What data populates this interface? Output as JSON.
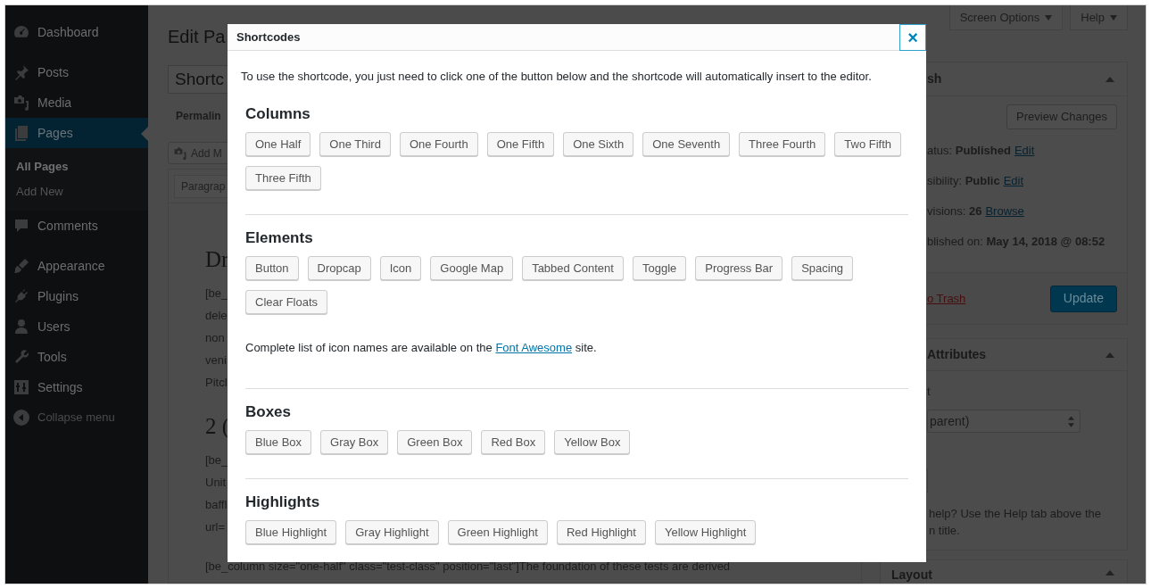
{
  "sidebar": {
    "items": [
      {
        "label": "Dashboard",
        "selected": false
      },
      {
        "label": "Posts",
        "selected": false
      },
      {
        "label": "Media",
        "selected": false
      },
      {
        "label": "Pages",
        "selected": true,
        "children": [
          {
            "label": "All Pages",
            "selected": true
          },
          {
            "label": "Add New",
            "selected": false
          }
        ]
      },
      {
        "label": "Comments",
        "selected": false
      },
      {
        "label": "Appearance",
        "selected": false
      },
      {
        "label": "Plugins",
        "selected": false
      },
      {
        "label": "Users",
        "selected": false
      },
      {
        "label": "Tools",
        "selected": false
      },
      {
        "label": "Settings",
        "selected": false
      }
    ],
    "collapse": "Collapse menu"
  },
  "top_buttons": [
    {
      "label": "Screen Options"
    },
    {
      "label": "Help"
    }
  ],
  "editor": {
    "heading": "Edit Pa",
    "title_value": "Shortc",
    "permalink": "Permalin",
    "add_media": "Add M",
    "format": "Paragrap",
    "content": [
      {
        "kind": "heading",
        "text": "Dr"
      },
      {
        "kind": "line",
        "text": "[be_"
      },
      {
        "kind": "line",
        "text": "dele"
      },
      {
        "kind": "line",
        "text": "non"
      },
      {
        "kind": "line",
        "text": "veni"
      },
      {
        "kind": "line",
        "text": "Pitcl"
      },
      {
        "kind": "heading",
        "text": "2 ("
      },
      {
        "kind": "line",
        "text": "[be_"
      },
      {
        "kind": "line",
        "text": "Unit"
      },
      {
        "kind": "line",
        "text": "baffl"
      },
      {
        "kind": "line",
        "text": "url="
      },
      {
        "kind": "line",
        "text": "[be_column size=\"one-half\" class=\"test-class\" position=\"last\"]The foundation of these tests are derived"
      }
    ]
  },
  "publish": {
    "title": "sh",
    "preview": "Preview Changes",
    "rows": [
      {
        "text": "atus: **Published**",
        "link": "Edit"
      },
      {
        "text": "sibility: **Public**",
        "link": "Edit"
      },
      {
        "text": "visions: **26**",
        "link": "Browse"
      },
      {
        "text": "blished on: **May 14, 2018 @ 08:52**"
      }
    ],
    "trash": "o Trash",
    "update": "Update"
  },
  "attributes": {
    "title": "Attributes",
    "label": "t",
    "select_value": "parent)",
    "help": "help? Use the Help tab above the",
    "help_2": "n title."
  },
  "layout": {
    "title": "Layout"
  },
  "modal": {
    "title": "Shortcodes",
    "close": "×",
    "intro": "To use the shortcode, you just need to click one of the button below and the shortcode will automatically insert to the editor.",
    "sections": [
      {
        "heading": "Columns",
        "buttons": [
          "One Half",
          "One Third",
          "One Fourth",
          "One Fifth",
          "One Sixth",
          "One Seventh",
          "Three Fourth",
          "Two Fifth",
          "Three Fifth"
        ]
      },
      {
        "heading": "Elements",
        "buttons": [
          "Button",
          "Dropcap",
          "Icon",
          "Google Map",
          "Tabbed Content",
          "Toggle",
          "Progress Bar",
          "Spacing",
          "Clear Floats"
        ],
        "note": {
          "before": "Complete list of icon names are available on the ",
          "link": "Font Awesome",
          "after": " site."
        }
      },
      {
        "heading": "Boxes",
        "buttons": [
          "Blue Box",
          "Gray Box",
          "Green Box",
          "Red Box",
          "Yellow Box"
        ]
      },
      {
        "heading": "Highlights",
        "buttons": [
          "Blue Highlight",
          "Gray Highlight",
          "Green Highlight",
          "Red Highlight",
          "Yellow Highlight"
        ]
      }
    ]
  }
}
